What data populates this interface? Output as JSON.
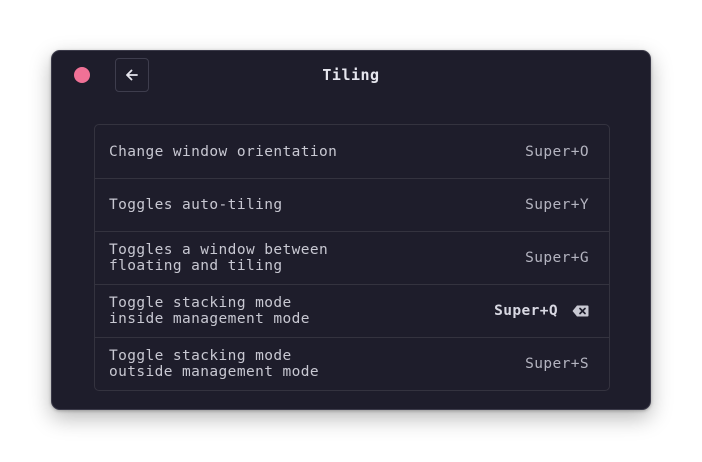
{
  "window": {
    "title": "Tiling"
  },
  "shortcuts": [
    {
      "label": "Change window orientation",
      "keys": "Super+O",
      "editing": false
    },
    {
      "label": "Toggles auto-tiling",
      "keys": "Super+Y",
      "editing": false
    },
    {
      "label": "Toggles a window between\nfloating and tiling",
      "keys": "Super+G",
      "editing": false
    },
    {
      "label": "Toggle stacking mode\ninside management mode",
      "keys": "Super+Q",
      "editing": true
    },
    {
      "label": "Toggle stacking mode\noutside management mode",
      "keys": "Super+S",
      "editing": false
    }
  ],
  "colors": {
    "background": "#1e1d2b",
    "close": "#f07196",
    "text": "#c8c8d2"
  },
  "icons": {
    "close": "close-dot-icon",
    "back": "arrow-left-icon",
    "clear": "backspace-icon"
  }
}
